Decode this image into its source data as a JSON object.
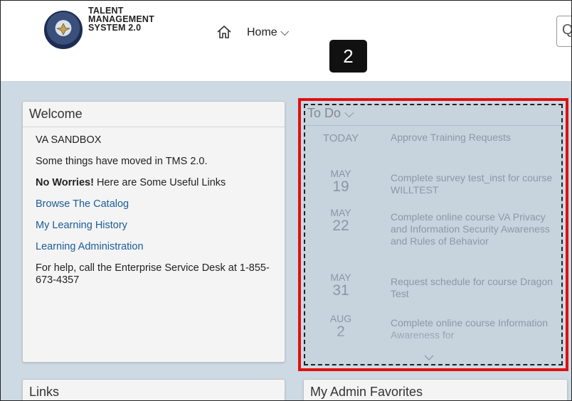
{
  "header": {
    "brand_line1": "TALENT",
    "brand_line2": "MANAGEMENT",
    "brand_line3": "SYSTEM 2.0",
    "home_label": "Home ⌵",
    "search_glyph": "Q"
  },
  "step_badge": "2",
  "welcome": {
    "title": "Welcome",
    "org": "VA SANDBOX",
    "moved_text": "Some things have moved in TMS 2.0.",
    "worries_bold": "No Worries!",
    "worries_rest": " Here are Some Useful Links",
    "link_catalog": "Browse The Catalog",
    "link_history": "My Learning History",
    "link_admin": "Learning Administration",
    "help_text": "For help, call the Enterprise Service Desk at 1-855-673-4357"
  },
  "todo": {
    "title": "To Do ⌵",
    "items": [
      {
        "date_today": "TODAY",
        "text": "Approve Training Requests"
      },
      {
        "month": "MAY",
        "day": "19",
        "text": "Complete survey test_inst for course WILLTEST"
      },
      {
        "month": "MAY",
        "day": "22",
        "text": "Complete online course VA Privacy and Information Security Awareness and Rules of Behavior"
      },
      {
        "month": "MAY",
        "day": "31",
        "text": "Request schedule for course Dragon Test"
      },
      {
        "month": "AUG",
        "day": "2",
        "text": "Complete online course Information Awareness for"
      }
    ]
  },
  "links_card": {
    "title": "Links"
  },
  "admin_card": {
    "title": "My Admin Favorites"
  },
  "colors": {
    "highlight_border": "#e01010",
    "content_bg": "#cddae4",
    "link": "#1a5d99"
  }
}
